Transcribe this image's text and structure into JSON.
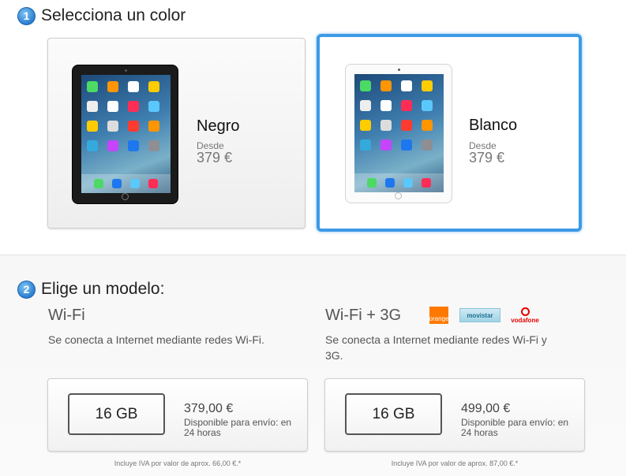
{
  "step1": {
    "number": "1",
    "title": "Selecciona un color"
  },
  "colors": [
    {
      "name": "Negro",
      "from_label": "Desde",
      "price": "379 €"
    },
    {
      "name": "Blanco",
      "from_label": "Desde",
      "price": "379 €"
    }
  ],
  "selected_color": "Blanco",
  "accent_color": "#3d9ae6",
  "step2": {
    "number": "2",
    "title": "Elige un modelo:"
  },
  "models": [
    {
      "title": "Wi-Fi",
      "description": "Se conecta a Internet mediante redes Wi-Fi.",
      "capacity": "16 GB",
      "price": "379,00 €",
      "availability": "Disponible para envío: en 24 horas",
      "tax_note": "Incluye IVA por valor de aprox. 66,00 €.*"
    },
    {
      "title": "Wi-Fi + 3G",
      "description": "Se conecta a Internet mediante redes Wi-Fi y 3G.",
      "capacity": "16 GB",
      "price": "499,00 €",
      "availability": "Disponible para envío: en 24 horas",
      "tax_note": "Incluye IVA por valor de aprox. 87,00 €.*",
      "carriers": [
        "orange",
        "movistar",
        "vodafone"
      ]
    }
  ]
}
